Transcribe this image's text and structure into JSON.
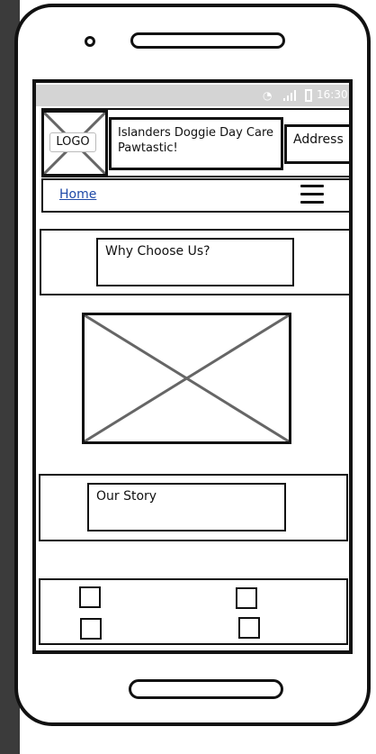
{
  "status_bar": {
    "time": "16:30",
    "wifi_icon": "wifi-icon",
    "signal_icon": "signal-icon",
    "battery_icon": "battery-icon"
  },
  "header": {
    "logo_label": "LOGO",
    "title_line1": "Islanders Doggie Day Care",
    "title_line2": "Pawtastic!",
    "address_label": "Address"
  },
  "nav": {
    "home_label": "Home",
    "menu_icon": "hamburger-menu-icon"
  },
  "sections": {
    "why_choose_us": "Why Choose Us?",
    "our_story": "Our Story"
  },
  "colors": {
    "link": "#1f4aa8",
    "status_bar": "#d4d4d4",
    "outline": "#111111"
  }
}
